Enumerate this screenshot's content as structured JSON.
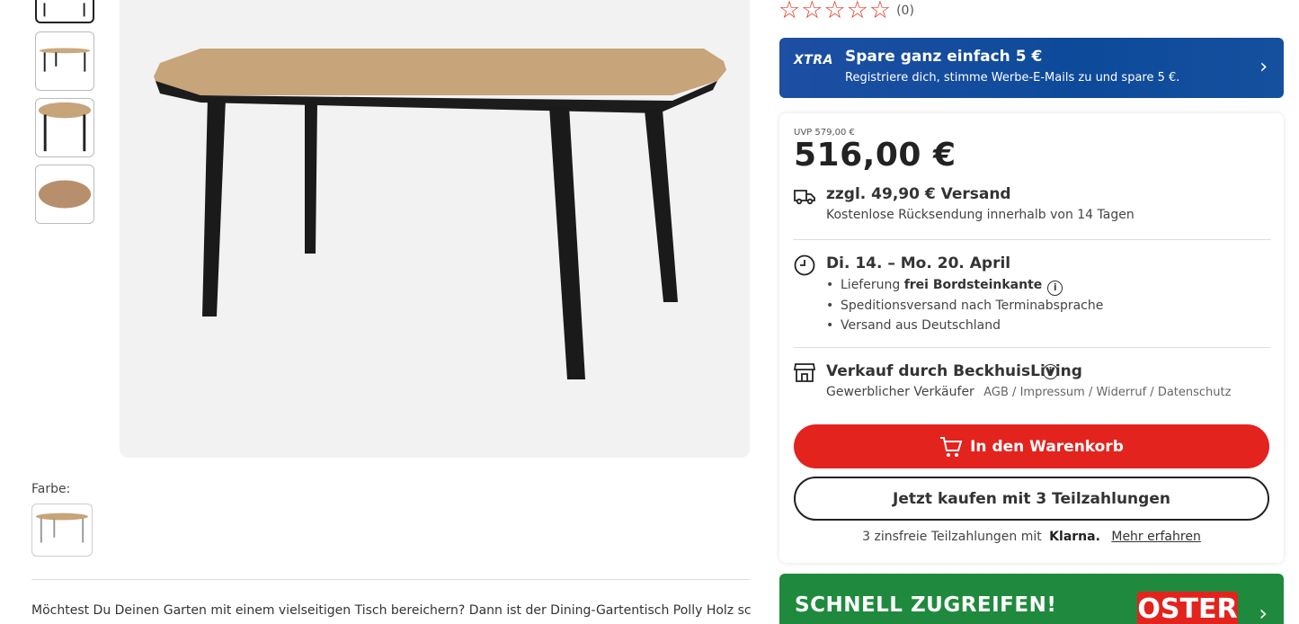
{
  "rating": {
    "stars": 0,
    "max": 5,
    "count_label": "(0)"
  },
  "xtra": {
    "logo": "XTRA",
    "title": "Spare ganz einfach 5 €",
    "subtitle": "Registriere dich, stimme Werbe-E-Mails zu und spare 5 €.",
    "arrow": "›"
  },
  "price": {
    "uvp": "UVP 579,00 €",
    "current": "516,00 €"
  },
  "shipping": {
    "title": "zzgl. 49,90 € Versand",
    "subtitle": "Kostenlose Rücksendung innerhalb von 14 Tagen"
  },
  "delivery": {
    "title": "Di. 14. – Mo. 20. April",
    "bullet1_prefix": "Lieferung ",
    "bullet1_bold": "frei Bordsteinkante",
    "bullet2": "Speditionsversand nach Terminabsprache",
    "bullet3": "Versand aus Deutschland",
    "info": "i"
  },
  "seller": {
    "title": "Verkauf durch BeckhuisLiving",
    "type": "Gewerblicher Verkäufer",
    "links": "AGB / Impressum / Widerruf / Datenschutz"
  },
  "buttons": {
    "cart": "In den Warenkorb",
    "klarna": "Jetzt kaufen mit 3 Teilzahlungen"
  },
  "klarna": {
    "text": "3 zinsfreie Teilzahlungen mit",
    "logo": "Klarna.",
    "more": "Mehr erfahren"
  },
  "promo": {
    "text": "SCHNELL ZUGREIFEN!",
    "badge": "OSTER",
    "arrow": "›"
  },
  "gallery": {
    "farbe_label": "Farbe:"
  },
  "description": "Möchtest Du Deinen Garten mit einem vielseitigen Tisch bereichern? Dann ist der Dining-Gartentisch Polly Holz schwarz eine",
  "colors": {
    "accent_red": "#e3231e",
    "xtra_blue": "#0d4a9a",
    "promo_green": "#1f8a3d"
  }
}
